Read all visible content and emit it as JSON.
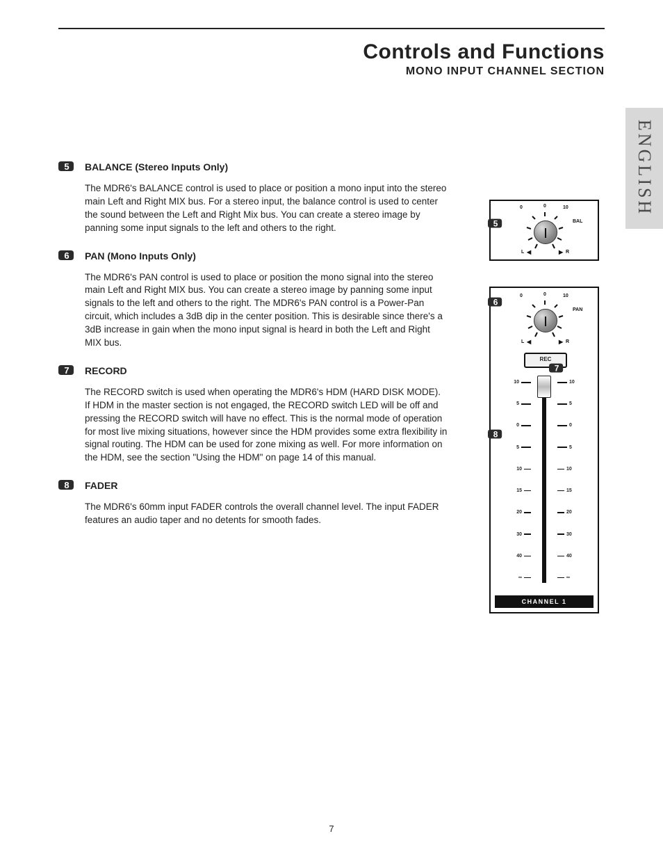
{
  "heading": {
    "title": "Controls and Functions",
    "subtitle": "MONO INPUT CHANNEL SECTION"
  },
  "side_tab": "ENGLISH",
  "page_number": "7",
  "items": [
    {
      "num": "5",
      "title": "BALANCE (Stereo Inputs Only)",
      "text": "The MDR6's BALANCE control is used to place or position a mono input into the stereo main Left and Right MIX bus. For a stereo input, the balance control is used to center the sound between the Left and Right Mix bus. You can create a stereo image by panning some input signals to the left and others to the right."
    },
    {
      "num": "6",
      "title": "PAN (Mono Inputs Only)",
      "text": "The MDR6's PAN control is used to place or position the mono signal into the stereo main Left and Right MIX bus. You can create a stereo image by panning some input signals to the left and others to the right. The MDR6's PAN control is a Power-Pan circuit, which includes a 3dB dip in the center position.  This is desirable since there's a 3dB increase in gain when the mono input signal is heard in both the Left and Right MIX bus."
    },
    {
      "num": "7",
      "title": "RECORD",
      "text": "The RECORD switch is used when operating the MDR6's HDM (HARD DISK MODE).  If HDM in the master section is not engaged, the RECORD switch LED will be off and pressing the RECORD switch will have no effect. This is the normal mode of operation for most live mixing situations, however since the HDM provides some extra flexibility in signal routing. The HDM can be used for zone mixing as well.  For more information on the HDM, see the section \"Using the HDM\" on page 14 of this manual."
    },
    {
      "num": "8",
      "title": "FADER",
      "text": "The MDR6's 60mm input FADER controls the overall channel level.  The input FADER features an audio taper and no detents for smooth fades."
    }
  ],
  "figure": {
    "bal": {
      "left_scale": "0",
      "center_scale": "0",
      "right_scale": "10",
      "label": "BAL",
      "left_letter": "L",
      "right_letter": "R",
      "callout": "5"
    },
    "pan": {
      "left_scale": "0",
      "center_scale": "0",
      "right_scale": "10",
      "label": "PAN",
      "left_letter": "L",
      "right_letter": "R",
      "callout": "6"
    },
    "rec": {
      "label": "REC",
      "callout": "7"
    },
    "fader": {
      "callout": "8",
      "marks": [
        "10",
        "5",
        "0",
        "5",
        "10",
        "15",
        "20",
        "30",
        "40",
        "∞"
      ]
    },
    "channel_label": "CHANNEL  1"
  }
}
